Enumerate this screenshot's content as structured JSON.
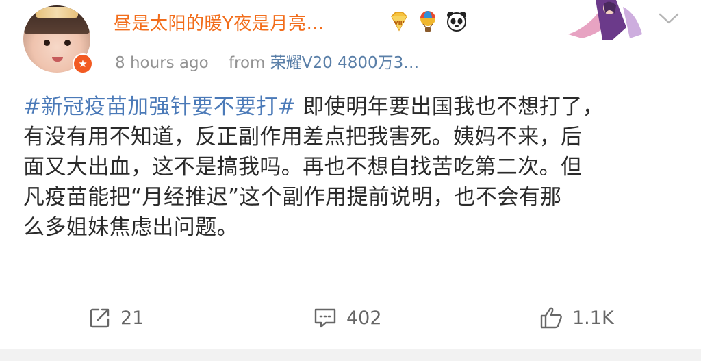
{
  "post": {
    "username": "昼是太阳的暖Y夜是月亮…",
    "time": "8 hours ago",
    "from_label": "from",
    "source": "荣耀V20 4800万3…",
    "topic": "#新冠疫苗加强针要不要打#",
    "body": " 即使明年要出国我也不想打了，有没有用不知道，反正副作用差点把我害死。姨妈不来，后面又大出血，这不是搞我吗。再也不想自找苦吃第二次。但凡疫苗能把“月经推迟”这个副作用提前说明，也不会有那么多姐妹焦虑出问题。",
    "body_lines": [
      "有没有用不知道，反正副作用差点把我害死。姨妈不来，后",
      "面又大出血，这不是搞我吗。再也不想自找苦吃第二次。但",
      "凡疫苗能把“月经推迟”这个副作用提前说明，也不会有那",
      "么多姐妹焦虑出问题。"
    ],
    "first_line_rest": " 即使明年要出国我也不想打了，",
    "vip_badge": "VIP",
    "icons": {
      "vip": "vip-diamond-icon",
      "balloon": "hot-air-balloon-icon",
      "panda": "panda-icon",
      "avatar_badge": "star-badge-icon",
      "chevron": "chevron-down-icon"
    }
  },
  "actions": {
    "repost_count": "21",
    "comment_count": "402",
    "like_count": "1.1K"
  },
  "colors": {
    "username": "#f26d1b",
    "topic": "#4b7ab8",
    "meta": "#939393"
  }
}
